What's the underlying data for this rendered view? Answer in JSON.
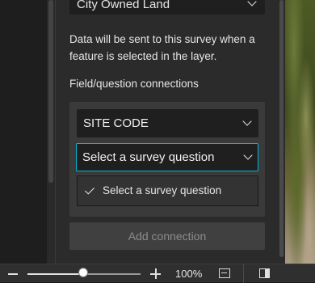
{
  "layer_select": {
    "value": "City Owned Land"
  },
  "description": "Data will be sent to this survey when a feature is selected in the layer.",
  "connections": {
    "label": "Field/question connections",
    "field_select": {
      "value": "SITE CODE"
    },
    "question_select": {
      "value": "Select a survey question",
      "focus_color": "#00b7d4"
    },
    "dropdown": {
      "items": [
        {
          "label": "Select a survey question",
          "selected": true
        }
      ]
    },
    "add_button_label": "Add connection"
  },
  "status_bar": {
    "zoom_level": "100%",
    "zoom_slider_position": 0.5,
    "icons": [
      "zoom-out-icon",
      "zoom-in-icon",
      "fit-to-window-icon",
      "toggle-panel-icon"
    ]
  }
}
